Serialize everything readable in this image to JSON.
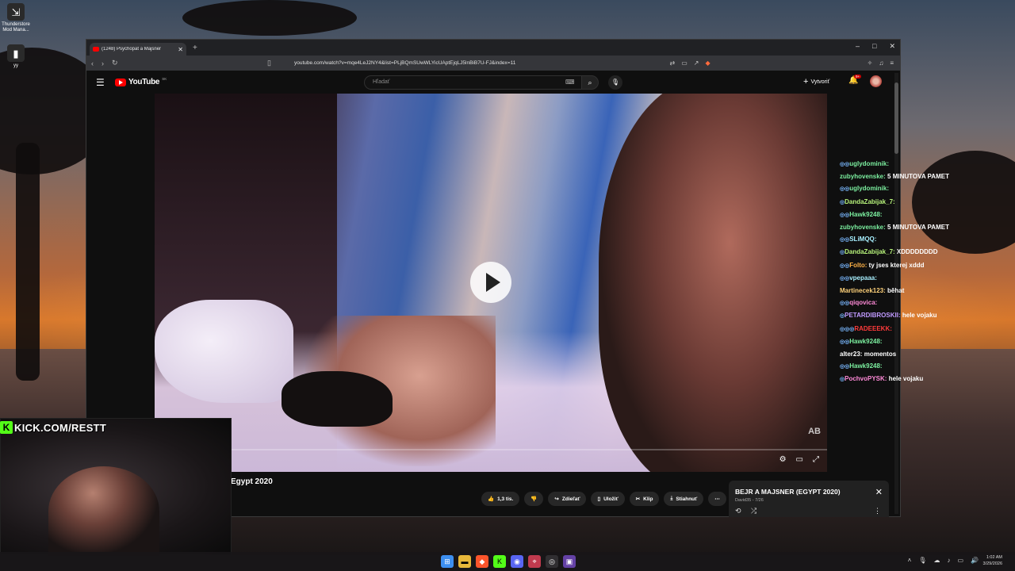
{
  "desktop": {
    "icons": [
      {
        "label": "Thunderstore Mod Mana...",
        "glyph": "⇲"
      },
      {
        "label": "yy",
        "glyph": "▮"
      }
    ]
  },
  "browser": {
    "tab_title": "(1248) Psychopat a Majsner",
    "url": "youtube.com/watch?v=mqe4LeJ2NY4&list=PLjBQmSUwWLYicUAptEjqLJ5lnBiB7U-FJ&index=11",
    "window_controls": [
      "–",
      "□",
      "✕"
    ]
  },
  "youtube": {
    "logo": "YouTube",
    "country": "SK",
    "search_placeholder": "Hľadať",
    "create_label": "Vytvoriť",
    "notification_count": "9+",
    "video": {
      "title": "Egypt 2020",
      "watermark": "AB",
      "like_count": "1,3 tis.",
      "share_label": "Zdieľať",
      "save_label": "Uložiť",
      "clip_label": "Klip",
      "download_label": "Stiahnuť",
      "progress": 0
    },
    "playlist": {
      "title": "BEJR A MAJSNER (EGYPT 2020)",
      "subtitle": "David35 - 7/26"
    }
  },
  "chat": {
    "messages": [
      {
        "user": "uglydominik:",
        "text": "",
        "color": "#7cf0a0",
        "badges": "◎◎"
      },
      {
        "user": "zubyhovenske:",
        "text": "5 MINUTOVA PAMET",
        "color": "#7cf0a0",
        "badges": ""
      },
      {
        "user": "uglydominik:",
        "text": "",
        "color": "#7cf0a0",
        "badges": "◎◎"
      },
      {
        "user": "DandaZabijak_7:",
        "text": "",
        "color": "#b6f27a",
        "badges": "◎"
      },
      {
        "user": "Hawk9248:",
        "text": "",
        "color": "#7cf0a0",
        "badges": "◎◎"
      },
      {
        "user": "zubyhovenske:",
        "text": "5 MINUTOVA PAMET",
        "color": "#7cf0a0",
        "badges": ""
      },
      {
        "user": "SLiMQQ:",
        "text": "",
        "color": "#a8f0ff",
        "badges": "◎◎"
      },
      {
        "user": "DandaZabijak_7:",
        "text": "XDDDDDDDD",
        "color": "#b6f27a",
        "badges": "◎"
      },
      {
        "user": "Folto:",
        "text": "ty jses kterej xddd",
        "color": "#ffb347",
        "badges": "◎◎"
      },
      {
        "user": "vpepaaa:",
        "text": "",
        "color": "#a8f0ff",
        "badges": "◎◎"
      },
      {
        "user": "Martinecek123:",
        "text": "běhat",
        "color": "#ffd27a",
        "badges": ""
      },
      {
        "user": "qiqovica:",
        "text": "",
        "color": "#ff8ad8",
        "badges": "◎◎"
      },
      {
        "user": "PETARDIBROSKII:",
        "text": "hele vojaku",
        "color": "#c09aff",
        "badges": "◎"
      },
      {
        "user": "RADEEEKK:",
        "text": "",
        "color": "#ff3b3b",
        "badges": "◎◎◎"
      },
      {
        "user": "Hawk9248:",
        "text": "",
        "color": "#7cf0a0",
        "badges": "◎◎"
      },
      {
        "user": "alter23:",
        "text": "momentos",
        "color": "#ffffff",
        "badges": ""
      },
      {
        "user": "Hawk9248:",
        "text": "",
        "color": "#7cf0a0",
        "badges": "◎◎"
      },
      {
        "user": "PochvoPYSK:",
        "text": "hele vojaku",
        "color": "#ff8ad8",
        "badges": "◎"
      }
    ]
  },
  "stream_overlay": {
    "kick_label": "KICK.COM/RESTT"
  },
  "taskbar": {
    "time": "1:02 AM",
    "date": "3/29/2026"
  }
}
